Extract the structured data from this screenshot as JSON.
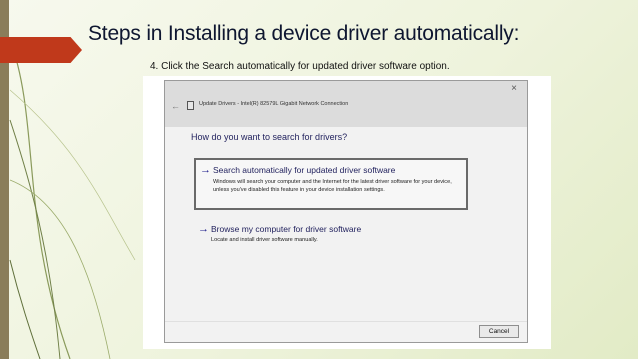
{
  "slide": {
    "title": "Steps in Installing a device driver automatically:",
    "step_text": "4. Click the Search automatically for updated driver software option."
  },
  "dialog": {
    "window_title": "Update Drivers - Intel(R) 82579L Gigabit Network Connection",
    "close_glyph": "×",
    "back_glyph": "←",
    "question": "How do you want to search for drivers?",
    "options": [
      {
        "arrow": "→",
        "title": "Search automatically for updated driver software",
        "description": "Windows will search your computer and the Internet for the latest driver software for your device, unless you've disabled this feature in your device installation settings."
      },
      {
        "arrow": "→",
        "title": "Browse my computer for driver software",
        "description": "Locate and install driver software manually."
      }
    ],
    "cancel_label": "Cancel"
  },
  "colors": {
    "title_accent": "#c0391b",
    "link_text": "#1f1f5c"
  }
}
